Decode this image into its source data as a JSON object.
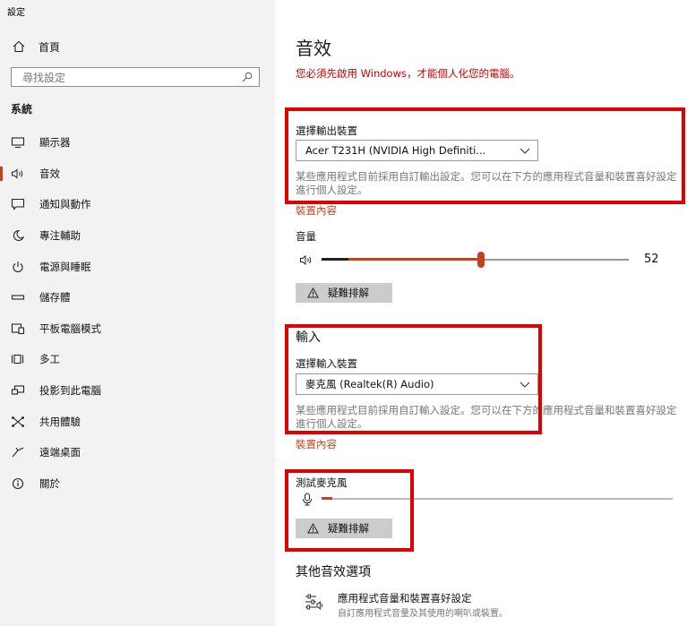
{
  "window": {
    "title": "設定"
  },
  "sidebar": {
    "home_label": "首頁",
    "search_placeholder": "尋找設定",
    "section_label": "系統",
    "items": [
      {
        "label": "顯示器",
        "icon": "monitor-icon"
      },
      {
        "label": "音效",
        "icon": "speaker-icon",
        "active": true
      },
      {
        "label": "通知與動作",
        "icon": "message-icon"
      },
      {
        "label": "專注輔助",
        "icon": "moon-icon"
      },
      {
        "label": "電源與睡眠",
        "icon": "power-icon"
      },
      {
        "label": "儲存體",
        "icon": "storage-icon"
      },
      {
        "label": "平板電腦模式",
        "icon": "tablet-icon"
      },
      {
        "label": "多工",
        "icon": "multitask-icon"
      },
      {
        "label": "投影到此電腦",
        "icon": "project-icon"
      },
      {
        "label": "共用體驗",
        "icon": "share-icon"
      },
      {
        "label": "遠端桌面",
        "icon": "remote-icon"
      },
      {
        "label": "關於",
        "icon": "info-icon"
      }
    ]
  },
  "main": {
    "title": "音效",
    "activation_warning": "您必須先啟用 Windows，才能個人化您的電腦。",
    "output": {
      "choose_label": "選擇輸出裝置",
      "device": "Acer T231H (NVIDIA High Definiti...",
      "description": "某些應用程式目前採用自訂輸出設定。您可以在下方的應用程式音量和裝置喜好設定進行個人設定。",
      "properties_link": "裝置內容",
      "volume_label": "音量",
      "volume_value": "52",
      "volume_fraction": 0.52,
      "troubleshoot_label": "疑難排解"
    },
    "input": {
      "heading": "輸入",
      "choose_label": "選擇輸入裝置",
      "device": "麥克風 (Realtek(R) Audio)",
      "description": "某些應用程式目前採用自訂輸入設定。您可以在下方的應用程式音量和裝置喜好設定進行個人設定。",
      "properties_link": "裝置內容",
      "test_label": "測試麥克風",
      "mic_level_fraction": 0.03,
      "troubleshoot_label": "疑難排解"
    },
    "other": {
      "heading": "其他音效選項",
      "app_volume_title": "應用程式音量和裝置喜好設定",
      "app_volume_desc": "自訂應用程式音量及其使用的喇叭或裝置。"
    }
  },
  "colors": {
    "accent": "#c4421a",
    "warning": "#cc0000",
    "highlight_box": "#e00000",
    "sidebar_bg": "#f2f2f2"
  }
}
